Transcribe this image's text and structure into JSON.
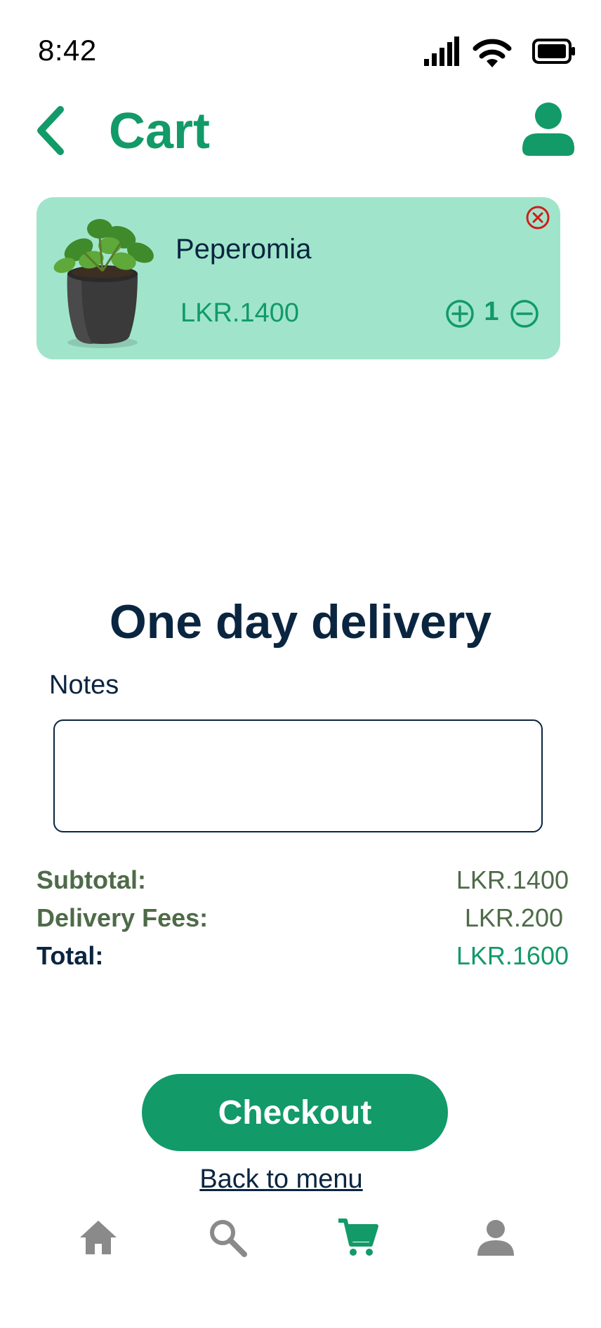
{
  "status_bar": {
    "time": "8:42",
    "icons": [
      "signal-icon",
      "wifi-icon",
      "battery-icon"
    ]
  },
  "header": {
    "title": "Cart",
    "back_icon": "chevron-left-icon",
    "profile_icon": "user-icon"
  },
  "cart": {
    "items": [
      {
        "name": "Peperomia",
        "price": "LKR.1400",
        "quantity": "1"
      }
    ]
  },
  "delivery": {
    "heading": "One day delivery",
    "notes_label": "Notes",
    "notes_value": ""
  },
  "summary": {
    "subtotal_label": "Subtotal:",
    "subtotal_value": "LKR.1400",
    "delivery_label": "Delivery Fees:",
    "delivery_value": "LKR.200",
    "total_label": "Total:",
    "total_value": "LKR.1600"
  },
  "actions": {
    "checkout_label": "Checkout",
    "back_label": "Back to menu"
  },
  "bottom_nav": {
    "items": [
      {
        "icon": "home-icon",
        "active": false
      },
      {
        "icon": "search-icon",
        "active": false
      },
      {
        "icon": "cart-icon",
        "active": true
      },
      {
        "icon": "user-icon",
        "active": false
      }
    ]
  },
  "colors": {
    "primary": "#129a68",
    "card_bg": "#a0e5cb",
    "navy": "#0a2540",
    "muted_green": "#4e6b48",
    "remove_red": "#d21c1c",
    "nav_gray": "#8a8a8a"
  }
}
